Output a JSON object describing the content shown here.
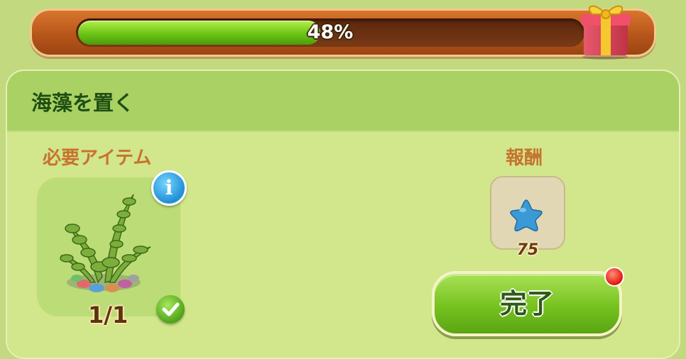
{
  "progress": {
    "percent": 48,
    "label": "48%"
  },
  "gift_icon": "gift-box-icon",
  "task": {
    "title": "海藻を置く"
  },
  "required": {
    "label": "必要アイテム",
    "item_icon": "seaweed-icon",
    "count_text": "1/1",
    "completed": true
  },
  "reward": {
    "label": "報酬",
    "icon": "blue-star-icon",
    "amount": "75"
  },
  "complete_button": {
    "label": "完了",
    "has_notification": true
  },
  "colors": {
    "progress_fill": "#6cc415",
    "button_green": "#76c21f",
    "title_text": "#1f4f12",
    "section_label": "#c6732e",
    "notification": "#e3160c"
  }
}
